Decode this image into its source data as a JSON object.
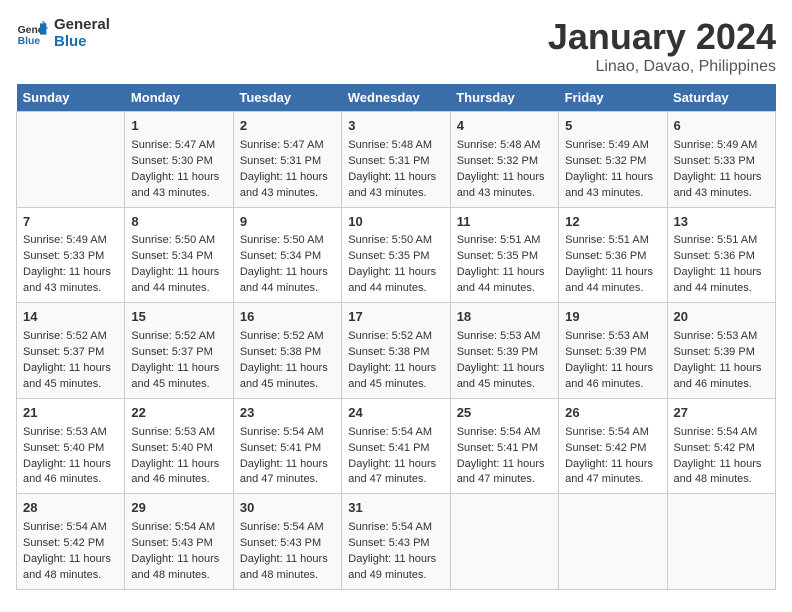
{
  "logo": {
    "line1": "General",
    "line2": "Blue"
  },
  "title": "January 2024",
  "subtitle": "Linao, Davao, Philippines",
  "days_of_week": [
    "Sunday",
    "Monday",
    "Tuesday",
    "Wednesday",
    "Thursday",
    "Friday",
    "Saturday"
  ],
  "weeks": [
    [
      {
        "day": "",
        "info": ""
      },
      {
        "day": "1",
        "info": "Sunrise: 5:47 AM\nSunset: 5:30 PM\nDaylight: 11 hours\nand 43 minutes."
      },
      {
        "day": "2",
        "info": "Sunrise: 5:47 AM\nSunset: 5:31 PM\nDaylight: 11 hours\nand 43 minutes."
      },
      {
        "day": "3",
        "info": "Sunrise: 5:48 AM\nSunset: 5:31 PM\nDaylight: 11 hours\nand 43 minutes."
      },
      {
        "day": "4",
        "info": "Sunrise: 5:48 AM\nSunset: 5:32 PM\nDaylight: 11 hours\nand 43 minutes."
      },
      {
        "day": "5",
        "info": "Sunrise: 5:49 AM\nSunset: 5:32 PM\nDaylight: 11 hours\nand 43 minutes."
      },
      {
        "day": "6",
        "info": "Sunrise: 5:49 AM\nSunset: 5:33 PM\nDaylight: 11 hours\nand 43 minutes."
      }
    ],
    [
      {
        "day": "7",
        "info": "Sunrise: 5:49 AM\nSunset: 5:33 PM\nDaylight: 11 hours\nand 43 minutes."
      },
      {
        "day": "8",
        "info": "Sunrise: 5:50 AM\nSunset: 5:34 PM\nDaylight: 11 hours\nand 44 minutes."
      },
      {
        "day": "9",
        "info": "Sunrise: 5:50 AM\nSunset: 5:34 PM\nDaylight: 11 hours\nand 44 minutes."
      },
      {
        "day": "10",
        "info": "Sunrise: 5:50 AM\nSunset: 5:35 PM\nDaylight: 11 hours\nand 44 minutes."
      },
      {
        "day": "11",
        "info": "Sunrise: 5:51 AM\nSunset: 5:35 PM\nDaylight: 11 hours\nand 44 minutes."
      },
      {
        "day": "12",
        "info": "Sunrise: 5:51 AM\nSunset: 5:36 PM\nDaylight: 11 hours\nand 44 minutes."
      },
      {
        "day": "13",
        "info": "Sunrise: 5:51 AM\nSunset: 5:36 PM\nDaylight: 11 hours\nand 44 minutes."
      }
    ],
    [
      {
        "day": "14",
        "info": "Sunrise: 5:52 AM\nSunset: 5:37 PM\nDaylight: 11 hours\nand 45 minutes."
      },
      {
        "day": "15",
        "info": "Sunrise: 5:52 AM\nSunset: 5:37 PM\nDaylight: 11 hours\nand 45 minutes."
      },
      {
        "day": "16",
        "info": "Sunrise: 5:52 AM\nSunset: 5:38 PM\nDaylight: 11 hours\nand 45 minutes."
      },
      {
        "day": "17",
        "info": "Sunrise: 5:52 AM\nSunset: 5:38 PM\nDaylight: 11 hours\nand 45 minutes."
      },
      {
        "day": "18",
        "info": "Sunrise: 5:53 AM\nSunset: 5:39 PM\nDaylight: 11 hours\nand 45 minutes."
      },
      {
        "day": "19",
        "info": "Sunrise: 5:53 AM\nSunset: 5:39 PM\nDaylight: 11 hours\nand 46 minutes."
      },
      {
        "day": "20",
        "info": "Sunrise: 5:53 AM\nSunset: 5:39 PM\nDaylight: 11 hours\nand 46 minutes."
      }
    ],
    [
      {
        "day": "21",
        "info": "Sunrise: 5:53 AM\nSunset: 5:40 PM\nDaylight: 11 hours\nand 46 minutes."
      },
      {
        "day": "22",
        "info": "Sunrise: 5:53 AM\nSunset: 5:40 PM\nDaylight: 11 hours\nand 46 minutes."
      },
      {
        "day": "23",
        "info": "Sunrise: 5:54 AM\nSunset: 5:41 PM\nDaylight: 11 hours\nand 47 minutes."
      },
      {
        "day": "24",
        "info": "Sunrise: 5:54 AM\nSunset: 5:41 PM\nDaylight: 11 hours\nand 47 minutes."
      },
      {
        "day": "25",
        "info": "Sunrise: 5:54 AM\nSunset: 5:41 PM\nDaylight: 11 hours\nand 47 minutes."
      },
      {
        "day": "26",
        "info": "Sunrise: 5:54 AM\nSunset: 5:42 PM\nDaylight: 11 hours\nand 47 minutes."
      },
      {
        "day": "27",
        "info": "Sunrise: 5:54 AM\nSunset: 5:42 PM\nDaylight: 11 hours\nand 48 minutes."
      }
    ],
    [
      {
        "day": "28",
        "info": "Sunrise: 5:54 AM\nSunset: 5:42 PM\nDaylight: 11 hours\nand 48 minutes."
      },
      {
        "day": "29",
        "info": "Sunrise: 5:54 AM\nSunset: 5:43 PM\nDaylight: 11 hours\nand 48 minutes."
      },
      {
        "day": "30",
        "info": "Sunrise: 5:54 AM\nSunset: 5:43 PM\nDaylight: 11 hours\nand 48 minutes."
      },
      {
        "day": "31",
        "info": "Sunrise: 5:54 AM\nSunset: 5:43 PM\nDaylight: 11 hours\nand 49 minutes."
      },
      {
        "day": "",
        "info": ""
      },
      {
        "day": "",
        "info": ""
      },
      {
        "day": "",
        "info": ""
      }
    ]
  ]
}
